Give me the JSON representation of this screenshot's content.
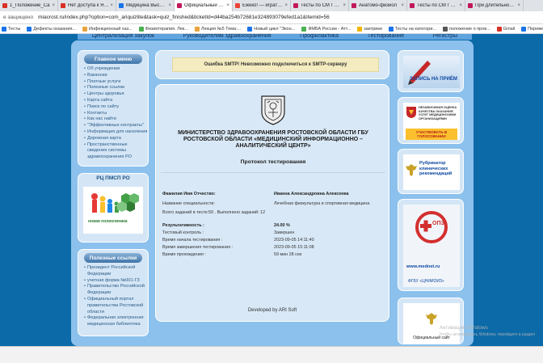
{
  "browser": {
    "tabs": [
      {
        "label": "1_Положение_Са",
        "color": "#d93025"
      },
      {
        "label": "Нет доступа к Яндек",
        "color": "#d93025"
      },
      {
        "label": "Медицина Высшее",
        "color": "#1a73e8"
      },
      {
        "label": "Официальный сайт",
        "color": "#c2185b"
      },
      {
        "label": "Ежеко! — играть с",
        "color": "#ea4335"
      },
      {
        "label": "Тесты по СМ г 2016",
        "color": "#c2185b"
      },
      {
        "label": "Анатомо-физиол",
        "color": "#c2185b"
      },
      {
        "label": "Тесты по СМ г 2016",
        "color": "#c2185b"
      },
      {
        "label": "При длительной ж",
        "color": "#c2185b"
      }
    ],
    "security_label": "е защищено",
    "url": "miacrost.ru/index.php?option=com_ariquizlite&task=quiz_finished&ticketId=d44ba254b72681e324893079efed1a1&Itemid=56",
    "bookmarks": [
      {
        "label": "Тесты",
        "color": "#1a73e8"
      },
      {
        "label": "Дефекты оказания...",
        "color": "#1a73e8"
      },
      {
        "label": "Инфекционный хаз...",
        "color": "#e8a33d"
      },
      {
        "label": "Физиотерапия. Лек...",
        "color": "#4caf50"
      },
      {
        "label": "Лекция №5 Тема:...",
        "color": "#e8a33d"
      },
      {
        "label": "Новый цикл \"Экон...",
        "color": "#1a73e8"
      },
      {
        "label": "ФМБА России - Атт...",
        "color": "#4caf50"
      },
      {
        "label": "заетрики",
        "color": "#f4b400"
      },
      {
        "label": "Тесты на категори...",
        "color": "#1a73e8"
      },
      {
        "label": "положение о пров...",
        "color": "#555555"
      },
      {
        "label": "Gmail",
        "color": "#d93025"
      },
      {
        "label": "Перевести",
        "color": "#1a73e8"
      }
    ]
  },
  "site": {
    "top_menu": [
      "Централизация закупок",
      "Руководителям здравоохранения",
      "Профилактика",
      "Тестирование",
      "Регистры"
    ],
    "main_menu_title": "Главное меню",
    "main_menu": [
      "Об учреждении",
      "Вакансии",
      "Платные услуги",
      "Полезные ссылки",
      "Центры здоровья",
      "Карта сайта",
      "Поиск по сайту",
      "Контакты",
      "Как нас найти",
      "\"Эффективные контракты\"",
      "Информация для населения",
      "Дорожная карта",
      "Пространственные сведения системы здравоохранения РО"
    ],
    "rc_title": "РЦ ПМСП РО",
    "rc_logo_text": "новая поликлиника",
    "links_title": "Полезные ссылки",
    "links": [
      "Президент Российской Федерации",
      "учетная форма №001-ГЗ",
      "Правительство Российской Федерации",
      "Официальный портал правительства Ростовской области",
      "Федеральная электронная медицинская библиотека"
    ]
  },
  "content": {
    "error": "Ошибка SMTP! Невозможно подключиться к SMTP-серверу",
    "ministry": "МИНИСТЕРСТВО  ЗДРАВООХРАНЕНИЯ РОСТОВСКОЙ ОБЛАСТИ ГБУ РОСТОВСКОЙ ОБЛАСТИ «МЕДИЦИНСКИЙ ИНФОРМАЦИОННО – АНАЛИТИЧЕСКИЙ ЦЕНТР»",
    "protocol_title": "Протокол тестирования",
    "name_label": "Фамилия Имя Отчество:",
    "name_value": "Иванна Александровна Алексеева",
    "spec_label": "Название специальности:",
    "spec_value": "Лечебная физкультура и спортивная медицина",
    "tasks_line": "Всего заданий в тесте:50 . Выполнено заданий: 12",
    "result_label": "Результативность :",
    "result_value": "24.00 %",
    "control_label": "Тестовый контроль :",
    "control_value": "Завершен",
    "start_label": "Время начала тестирования :",
    "start_value": "2023-09-05 14:11:40",
    "end_label": "Время завершения тестирования :",
    "end_value": "2023-09-05 15:11:08",
    "duration_label": "Время прохождения :",
    "duration_value": "59 мин 28 сек",
    "developed_by": "Developed by ARI Soft"
  },
  "right": {
    "banner1": "запись на приём",
    "banner2_top": "НЕЗАВИСИМАЯ ОЦЕНКА КАЧЕСТВА ОКАЗАНИЯ УСЛУГ МЕДИЦИНСКИМИ ОРГАНИЗАЦИЯМИ",
    "banner2_bottom": "УЧАСТВОВАТЬ В ГОЛОСОВАНИИ",
    "banner3": "Рубрикатор клинических рекомендаций",
    "banner4_top": "ОПЗ",
    "banner4_url": "www.mednet.ru",
    "banner4_org": "ФГБУ «ЦНИИОИЗ»",
    "banner5": "Официальный сайт"
  },
  "watermark": {
    "line1": "Активация Windows",
    "line2": "Чтобы активировать Windows, перейдите в раздел \"Параметры\"."
  }
}
